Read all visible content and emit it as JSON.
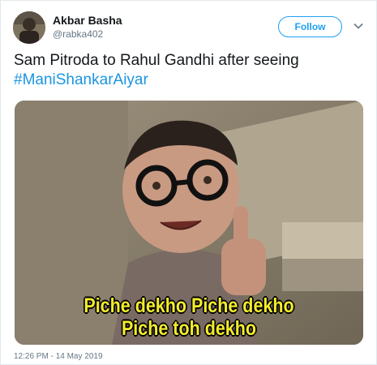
{
  "user": {
    "name": "Akbar Basha",
    "handle": "@rabka402"
  },
  "follow_label": "Follow",
  "tweet": {
    "text": "Sam Pitroda to Rahul Gandhi after seeing",
    "hashtag": "#ManiShankarAiyar"
  },
  "media": {
    "caption_line1": "Piche dekho Piche dekho",
    "caption_line2": "Piche toh dekho"
  },
  "timestamp": "12:26 PM - 14 May 2019",
  "icons": {
    "more": "chevron-down-icon"
  },
  "colors": {
    "accent": "#1da1f2",
    "hashtag": "#1b95e0",
    "caption": "#f4ec2c"
  }
}
